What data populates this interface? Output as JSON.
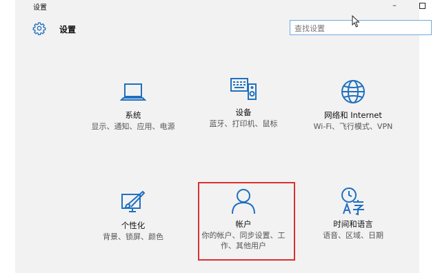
{
  "window": {
    "title": "设置",
    "minimize": "–"
  },
  "header": {
    "title": "设置",
    "icon": "gear-icon"
  },
  "search": {
    "placeholder": "查找设置"
  },
  "tiles": [
    {
      "icon": "laptop-icon",
      "name": "系统",
      "desc": "显示、通知、应用、电源"
    },
    {
      "icon": "keyboard-speaker-icon",
      "name": "设备",
      "desc": "蓝牙、打印机、鼠标"
    },
    {
      "icon": "globe-icon",
      "name": "网络和 Internet",
      "desc": "Wi-Fi、飞行模式、VPN"
    },
    {
      "icon": "paintbrush-screen-icon",
      "name": "个性化",
      "desc": "背景、锁屏、颜色"
    },
    {
      "icon": "person-icon",
      "name": "帐户",
      "desc": "你的帐户、同步设置、工作、其他用户"
    },
    {
      "icon": "clock-language-icon",
      "name": "时间和语言",
      "desc": "语音、区域、日期"
    }
  ],
  "colors": {
    "accent": "#1f6fc0",
    "highlight": "#d9302c"
  }
}
